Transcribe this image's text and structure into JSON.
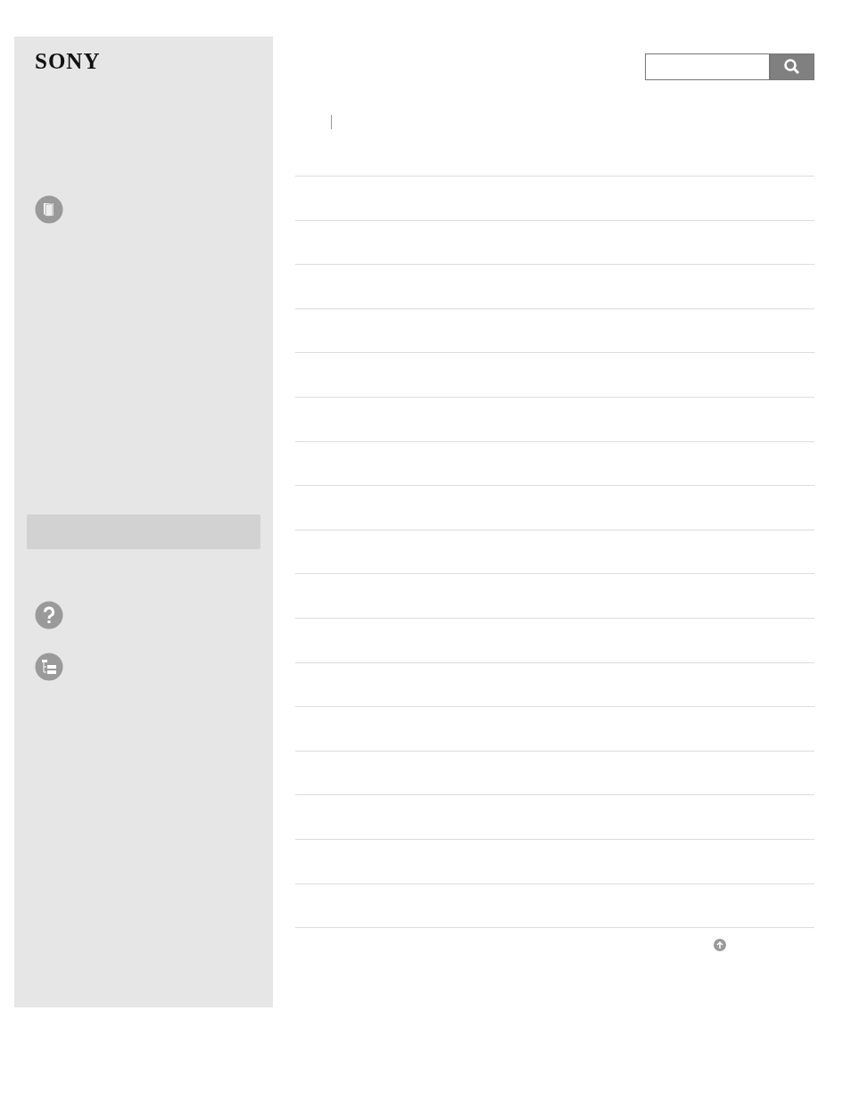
{
  "logo": {
    "text": "SONY"
  }
}
